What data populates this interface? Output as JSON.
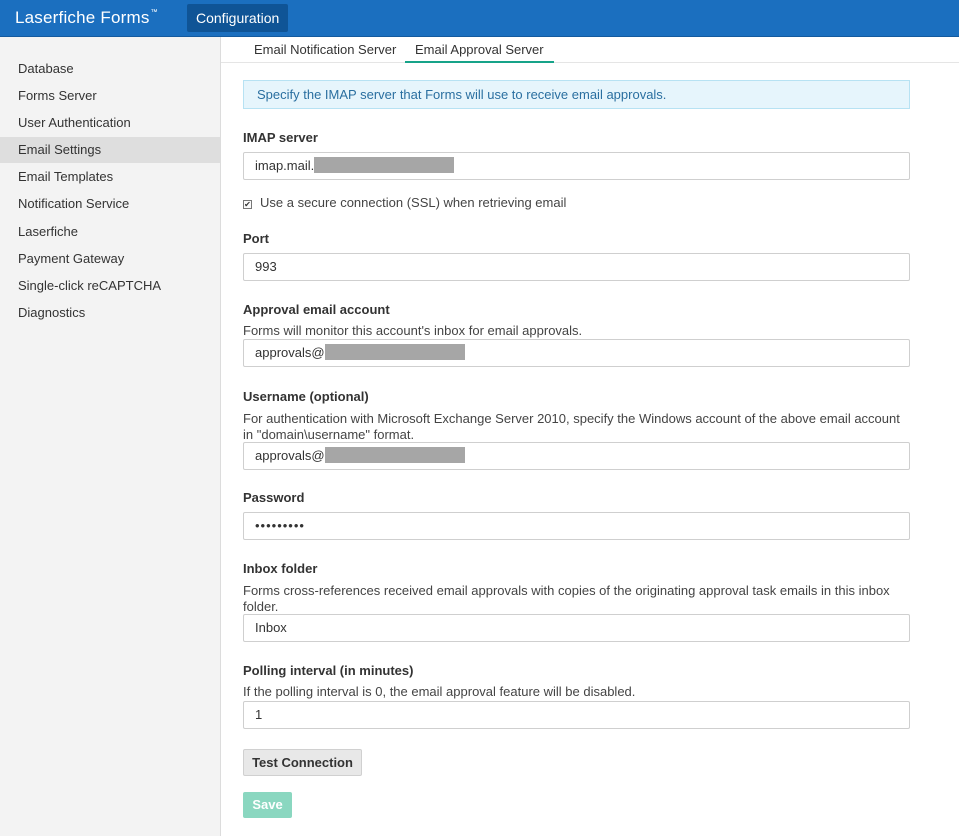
{
  "app": {
    "brand": "Laserfiche Forms",
    "trademark": "™",
    "nav_active": "Configuration"
  },
  "sidebar": {
    "items": [
      {
        "label": "Database"
      },
      {
        "label": "Forms Server"
      },
      {
        "label": "User Authentication"
      },
      {
        "label": "Email Settings",
        "active": true
      },
      {
        "label": "Email Templates"
      },
      {
        "label": "Notification Service"
      },
      {
        "label": "Laserfiche"
      },
      {
        "label": "Payment Gateway"
      },
      {
        "label": "Single-click reCAPTCHA"
      },
      {
        "label": "Diagnostics"
      }
    ]
  },
  "tabs": [
    {
      "label": "Email Notification Server",
      "active": false
    },
    {
      "label": "Email Approval Server",
      "active": true
    }
  ],
  "info_text": "Specify the IMAP server that Forms will use to receive email approvals.",
  "form": {
    "imap": {
      "label": "IMAP server",
      "value": "imap.mail."
    },
    "ssl": {
      "label": "Use a secure connection (SSL) when retrieving email",
      "checked": true,
      "check_glyph": "✔"
    },
    "port": {
      "label": "Port",
      "value": "993"
    },
    "approval_account": {
      "label": "Approval email account",
      "help": "Forms will monitor this account's inbox for email approvals.",
      "value": "approvals@"
    },
    "username": {
      "label": "Username (optional)",
      "help": "For authentication with Microsoft Exchange Server 2010, specify the Windows account of the above email account in \"domain\\username\" format.",
      "value": "approvals@"
    },
    "password": {
      "label": "Password",
      "value": "•••••••••"
    },
    "inbox": {
      "label": "Inbox folder",
      "help": "Forms cross-references received email approvals with copies of the originating approval task emails in this inbox folder.",
      "value": "Inbox"
    },
    "polling": {
      "label": "Polling interval (in minutes)",
      "help": "If the polling interval is 0, the email approval feature will be disabled.",
      "value": "1"
    }
  },
  "buttons": {
    "test": "Test Connection",
    "save": "Save"
  },
  "colors": {
    "header": "#1b6fbf",
    "nav_active": "#0f5496",
    "tab_underline": "#17a389",
    "save": "#8ad7c0",
    "info_bg": "#e6f5fc"
  }
}
